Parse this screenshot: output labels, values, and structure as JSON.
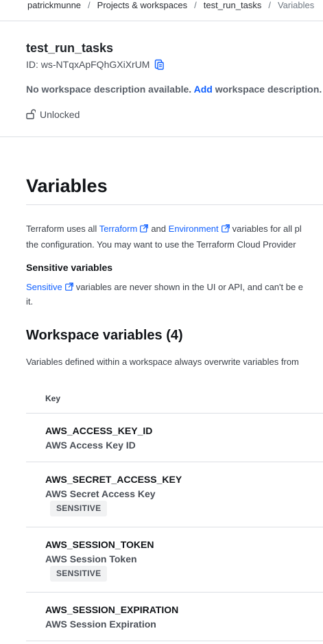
{
  "breadcrumb": {
    "items": [
      "patrickmunne",
      "Projects & workspaces",
      "test_run_tasks"
    ],
    "current": "Variables",
    "separator": "/"
  },
  "workspace": {
    "name": "test_run_tasks",
    "id_label": "ID: ws-NTqxApFQhGXiXrUM",
    "description_prefix": "No workspace description available.",
    "description_link": "Add",
    "description_suffix": "workspace description.",
    "lock_status": "Unlocked"
  },
  "page": {
    "title": "Variables",
    "intro_1": "Terraform uses all",
    "intro_link_terraform": "Terraform",
    "intro_and": "and",
    "intro_link_environment": "Environment",
    "intro_2": "variables for all pl",
    "intro_line2": "the configuration. You may want to use the Terraform Cloud Provider",
    "sensitive_heading": "Sensitive variables",
    "sensitive_link": "Sensitive",
    "sensitive_text": "variables are never shown in the UI or API, and can't be e",
    "sensitive_line2": "it."
  },
  "workspace_variables": {
    "heading": "Workspace variables (4)",
    "description": "Variables defined within a workspace always overwrite variables from",
    "column_key": "Key",
    "rows": [
      {
        "key": "AWS_ACCESS_KEY_ID",
        "description": "AWS Access Key ID",
        "badge": ""
      },
      {
        "key": "AWS_SECRET_ACCESS_KEY",
        "description": "AWS Secret Access Key",
        "badge": "SENSITIVE"
      },
      {
        "key": "AWS_SESSION_TOKEN",
        "description": "AWS Session Token",
        "badge": "SENSITIVE"
      },
      {
        "key": "AWS_SESSION_EXPIRATION",
        "description": "AWS Session Expiration",
        "badge": ""
      }
    ]
  },
  "colors": {
    "link": "#1060ff",
    "text": "#1f2328",
    "muted": "#4a4f57",
    "divider": "#dcdfe4",
    "badge_bg": "#f1f2f3"
  },
  "icons": {
    "copy": "copy-icon",
    "lock": "unlocked-padlock-icon",
    "external": "external-link-icon"
  }
}
